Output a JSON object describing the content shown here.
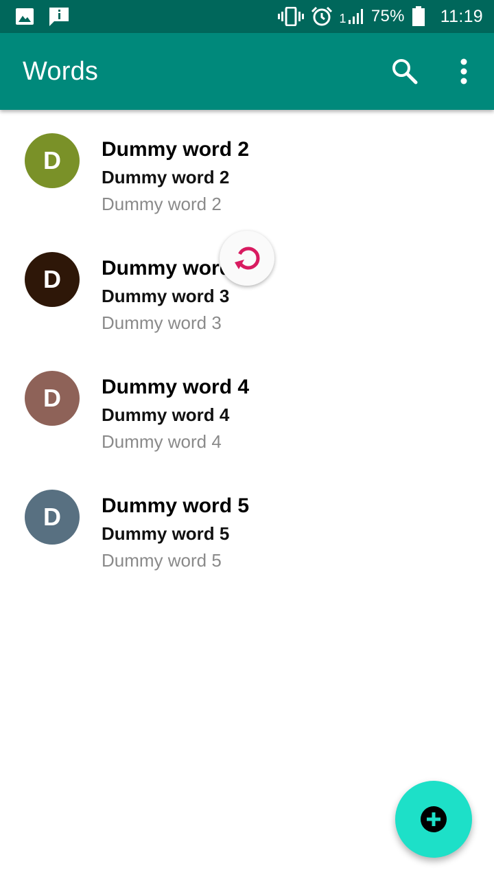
{
  "status_bar": {
    "left_icons": [
      "image-icon",
      "info-message-icon"
    ],
    "right_icons": [
      "vibrate-icon",
      "alarm-icon",
      "signal-icon",
      "battery-icon"
    ],
    "signal_label": "1",
    "battery": "75%",
    "time": "11:19",
    "color": "#00675b"
  },
  "app_bar": {
    "title": "Words",
    "color": "#00897b",
    "actions": [
      "search-icon",
      "more-vert-icon"
    ]
  },
  "words": [
    {
      "initial": "D",
      "title": "Dummy word 2",
      "subtitle": "Dummy word 2",
      "detail": "Dummy word 2",
      "color": "#7a9128"
    },
    {
      "initial": "D",
      "title": "Dummy word 3",
      "subtitle": "Dummy word 3",
      "detail": "Dummy word 3",
      "color": "#2e1708"
    },
    {
      "initial": "D",
      "title": "Dummy word 4",
      "subtitle": "Dummy word 4",
      "detail": "Dummy word 4",
      "color": "#8e6258"
    },
    {
      "initial": "D",
      "title": "Dummy word 5",
      "subtitle": "Dummy word 5",
      "detail": "Dummy word 5",
      "color": "#587081"
    }
  ],
  "refresh": {
    "icon": "refresh-icon",
    "color": "#d81b60"
  },
  "fab": {
    "icon": "add-circle-icon",
    "color": "#1de0c8"
  }
}
